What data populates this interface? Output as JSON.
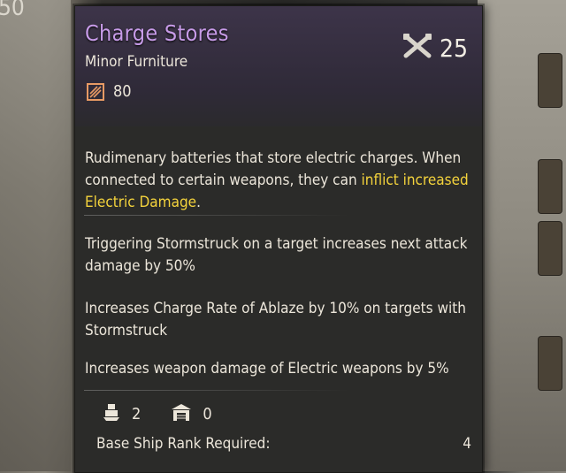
{
  "background": {
    "left_number": "50"
  },
  "item": {
    "name": "Charge Stores",
    "category": "Minor Furniture",
    "stat_value": "80",
    "level": "25",
    "description": {
      "part1": "Rudimenary batteries that store electric charges. When connected to certain weapons, they can ",
      "highlight": "inflict increased Electric Damage",
      "part2": "."
    },
    "effects": [
      "Triggering Stormstruck on a target increases next attack damage by 50%",
      "Increases Charge Rate of Ablaze by 10% on targets with Stormstruck",
      "Increases weapon damage of Electric weapons by 5%"
    ],
    "footer": {
      "crew_count": "2",
      "storage_count": "0",
      "rank_label": "Base Ship Rank Required:",
      "rank_value": "4"
    }
  },
  "colors": {
    "title": "#c79be8",
    "highlight": "#f4d33c",
    "stat_icon": "#e79a64"
  },
  "icons": {
    "stat": "durability-icon",
    "level": "crossed-cannons-icon",
    "crew": "ship-crew-icon",
    "storage": "storage-icon"
  }
}
